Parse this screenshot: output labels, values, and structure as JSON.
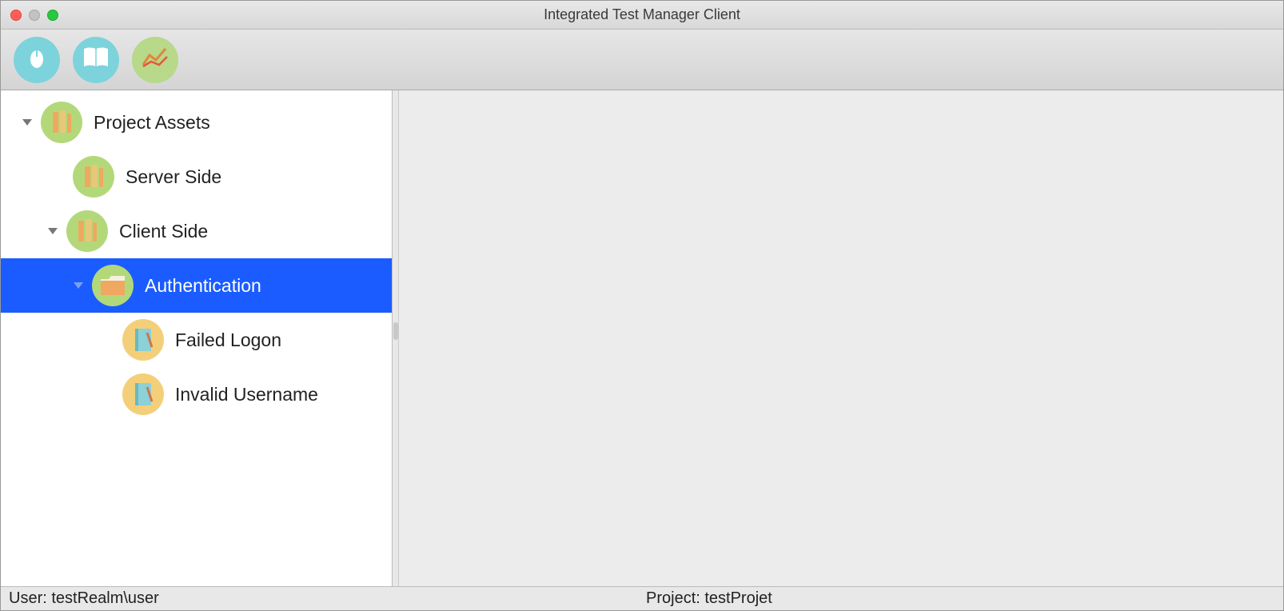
{
  "window": {
    "title": "Integrated Test Manager Client"
  },
  "toolbar": {
    "buttons": [
      {
        "name": "mouse-tool",
        "icon": "mouse-icon"
      },
      {
        "name": "book-tool",
        "icon": "book-icon"
      },
      {
        "name": "chart-tool",
        "icon": "chart-icon"
      }
    ]
  },
  "tree": {
    "root": {
      "label": "Project Assets",
      "icon": "books-icon",
      "expanded": true
    },
    "server_side": {
      "label": "Server Side",
      "icon": "books-icon"
    },
    "client_side": {
      "label": "Client Side",
      "icon": "books-icon",
      "expanded": true
    },
    "authentication": {
      "label": "Authentication",
      "icon": "folder-icon",
      "expanded": true,
      "selected": true
    },
    "failed_logon": {
      "label": "Failed Logon",
      "icon": "notebook-icon"
    },
    "invalid_username": {
      "label": "Invalid Username",
      "icon": "notebook-icon"
    }
  },
  "statusbar": {
    "user_prefix": "User: ",
    "user_value": "testRealm\\user",
    "project_prefix": "Project: ",
    "project_value": "testProjet"
  }
}
